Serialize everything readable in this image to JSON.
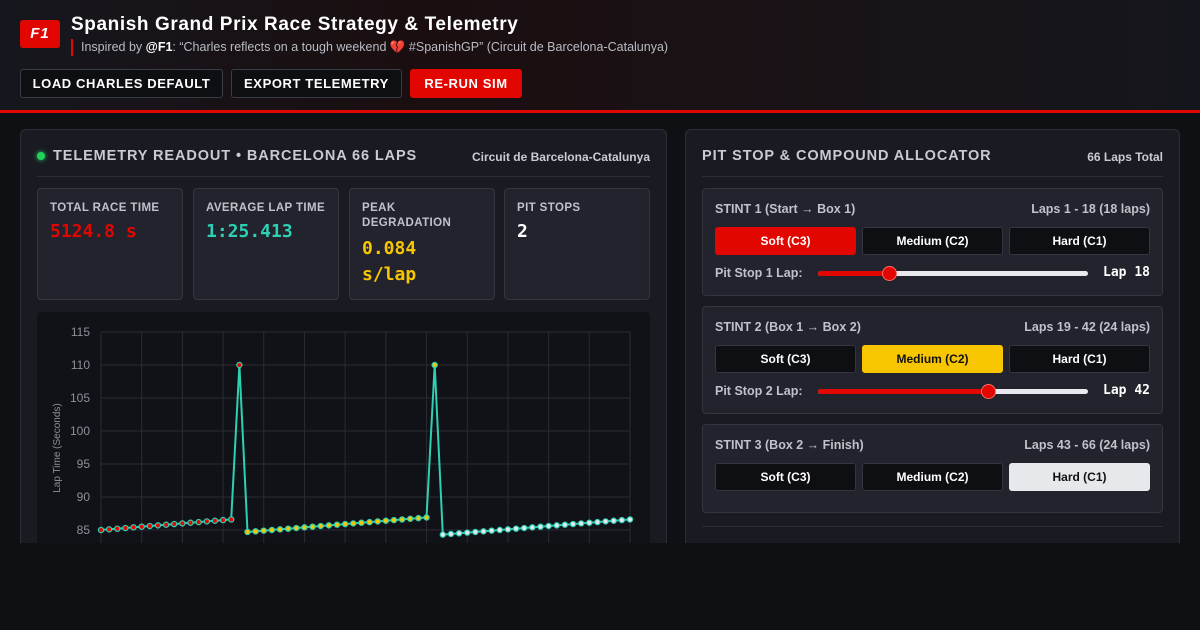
{
  "header": {
    "logo": "F1",
    "title": "Spanish Grand Prix Race Strategy & Telemetry",
    "subtitle_prefix": "Inspired by ",
    "subtitle_handle": "@F1",
    "subtitle_quote": ": “Charles reflects on a tough weekend 💔 #SpanishGP” (Circuit de Barcelona-Catalunya)"
  },
  "toolbar": {
    "load_label": "LOAD CHARLES DEFAULT",
    "export_label": "EXPORT TELEMETRY",
    "rerun_label": "RE-RUN SIM"
  },
  "telemetry": {
    "title": "TELEMETRY READOUT • BARCELONA 66 LAPS",
    "circuit": "Circuit de Barcelona-Catalunya",
    "stats": [
      {
        "label": "TOTAL RACE TIME",
        "value": "5124.8 s",
        "color": "#e10600"
      },
      {
        "label": "AVERAGE LAP TIME",
        "value": "1:25.413",
        "color": "#2ed0b5"
      },
      {
        "label": "PEAK DEGRADATION",
        "value": "0.084 s/lap",
        "color": "#f7c600"
      },
      {
        "label": "PIT STOPS",
        "value": "2",
        "color": "#ffffff"
      }
    ]
  },
  "chart_data": {
    "type": "line",
    "ylabel": "Lap Time (Seconds)",
    "ylim": [
      85,
      115
    ],
    "yticks": [
      85,
      90,
      95,
      100,
      105,
      110,
      115
    ],
    "grid": true,
    "line_color": "#2ed0b5",
    "marker_colors": {
      "soft": "#e10600",
      "medium": "#f7c600",
      "hard": "#e6e8ec"
    },
    "x": [
      1,
      2,
      3,
      4,
      5,
      6,
      7,
      8,
      9,
      10,
      11,
      12,
      13,
      14,
      15,
      16,
      17,
      18,
      19,
      20,
      21,
      22,
      22,
      23,
      24,
      25,
      26,
      27,
      28,
      29,
      30,
      31,
      32,
      33,
      34,
      35,
      36,
      37,
      38,
      39,
      40,
      41,
      42,
      43,
      44,
      45,
      46,
      47,
      48,
      49,
      50,
      51,
      52,
      53,
      54,
      55,
      56,
      57,
      58,
      59,
      60,
      61,
      62,
      63,
      64,
      65,
      66
    ],
    "laps": [
      1,
      2,
      3,
      4,
      5,
      6,
      7,
      8,
      9,
      10,
      11,
      12,
      13,
      14,
      15,
      16,
      17,
      18,
      19,
      20,
      21,
      22,
      23,
      24,
      25,
      26,
      27,
      28,
      29,
      30,
      31,
      32,
      33,
      34,
      35,
      36,
      37,
      38,
      39,
      40,
      41,
      42,
      43,
      44,
      45,
      46,
      47,
      48,
      49,
      50,
      51,
      52,
      53,
      54,
      55,
      56,
      57,
      58,
      59,
      60,
      61,
      62,
      63,
      64,
      65,
      66
    ],
    "values": [
      85.0,
      85.1,
      85.2,
      85.3,
      85.4,
      85.5,
      85.6,
      85.7,
      85.8,
      85.9,
      86.0,
      86.1,
      86.2,
      86.3,
      86.4,
      86.5,
      86.6,
      110.0,
      84.7,
      84.8,
      84.9,
      85.0,
      85.1,
      85.2,
      85.3,
      85.4,
      85.5,
      85.6,
      85.7,
      85.8,
      85.9,
      86.0,
      86.1,
      86.2,
      86.3,
      86.4,
      86.5,
      86.6,
      86.7,
      86.8,
      86.9,
      110.0,
      84.3,
      84.4,
      84.5,
      84.6,
      84.7,
      84.8,
      84.9,
      85.0,
      85.1,
      85.2,
      85.3,
      85.4,
      85.5,
      85.6,
      85.7,
      85.8,
      85.9,
      86.0,
      86.1,
      86.2,
      86.3,
      86.4,
      86.5,
      86.6
    ],
    "compound": [
      "soft",
      "soft",
      "soft",
      "soft",
      "soft",
      "soft",
      "soft",
      "soft",
      "soft",
      "soft",
      "soft",
      "soft",
      "soft",
      "soft",
      "soft",
      "soft",
      "soft",
      "soft",
      "medium",
      "medium",
      "medium",
      "medium",
      "medium",
      "medium",
      "medium",
      "medium",
      "medium",
      "medium",
      "medium",
      "medium",
      "medium",
      "medium",
      "medium",
      "medium",
      "medium",
      "medium",
      "medium",
      "medium",
      "medium",
      "medium",
      "medium",
      "medium",
      "hard",
      "hard",
      "hard",
      "hard",
      "hard",
      "hard",
      "hard",
      "hard",
      "hard",
      "hard",
      "hard",
      "hard",
      "hard",
      "hard",
      "hard",
      "hard",
      "hard",
      "hard",
      "hard",
      "hard",
      "hard",
      "hard",
      "hard",
      "hard"
    ]
  },
  "allocator": {
    "title": "PIT STOP & COMPOUND ALLOCATOR",
    "total": "66 Laps Total",
    "stints": [
      {
        "title": "STINT 1 (Start → Box 1)",
        "laps": "Laps 1 - 18 (18 laps)",
        "selected": "soft",
        "pit_label": "Pit Stop 1 Lap:",
        "pit_lap_text": "Lap 18",
        "pit_lap": 18
      },
      {
        "title": "STINT 2 (Box 1 → Box 2)",
        "laps": "Laps 19 - 42 (24 laps)",
        "selected": "medium",
        "pit_label": "Pit Stop 2 Lap:",
        "pit_lap_text": "Lap 42",
        "pit_lap": 42
      },
      {
        "title": "STINT 3 (Box 2 → Finish)",
        "laps": "Laps 43 - 66 (24 laps)",
        "selected": "hard"
      }
    ],
    "tyre_labels": {
      "soft": "Soft (C3)",
      "medium": "Medium (C2)",
      "hard": "Hard (C1)"
    },
    "slider_range": [
      1,
      66
    ]
  }
}
